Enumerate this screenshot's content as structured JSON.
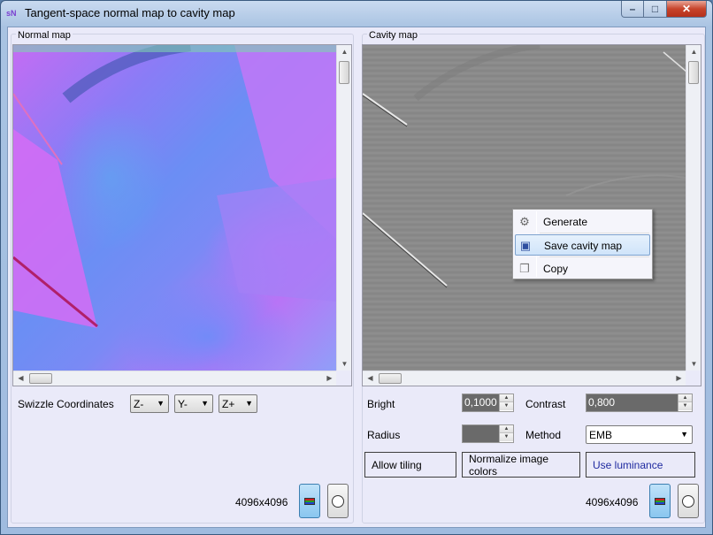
{
  "window": {
    "app_icon": "sN",
    "title": "Tangent-space normal map to cavity map",
    "minimize": "–",
    "maximize": "□",
    "close": "✕"
  },
  "left_panel": {
    "group_label": "Normal map",
    "swizzle_label": "Swizzle Coordinates",
    "swizzle": [
      {
        "value": "Z-"
      },
      {
        "value": "Y-"
      },
      {
        "value": "Z+"
      }
    ],
    "image_size": "4096x4096"
  },
  "right_panel": {
    "group_label": "Cavity map",
    "bright_label": "Bright",
    "bright_value": "0,1000",
    "contrast_label": "Contrast",
    "contrast_value": "0,800",
    "radius_label": "Radius",
    "radius_value": "",
    "method_label": "Method",
    "method_value": "EMB",
    "allow_tiling": "Allow tiling",
    "normalize_colors": "Normalize image colors",
    "use_luminance": "Use luminance",
    "image_size": "4096x4096"
  },
  "context_menu": {
    "items": [
      {
        "label": "Generate",
        "icon": "gear-icon"
      },
      {
        "label": "Save cavity map",
        "icon": "floppy-disk-icon"
      },
      {
        "label": "Copy",
        "icon": "copy-icon"
      }
    ]
  },
  "glyphs": {
    "up": "▲",
    "down": "▼",
    "left": "◀",
    "right": "▶",
    "grip_v": "≡",
    "grip_h": "III",
    "dropdown": "▼",
    "gear": "⚙",
    "floppy": "▣",
    "copy": "❐"
  },
  "colors": {
    "client_bg": "#eaeaf9",
    "menu_highlight": "#cfe4fa",
    "pressed_button": "#8ac6ef"
  }
}
